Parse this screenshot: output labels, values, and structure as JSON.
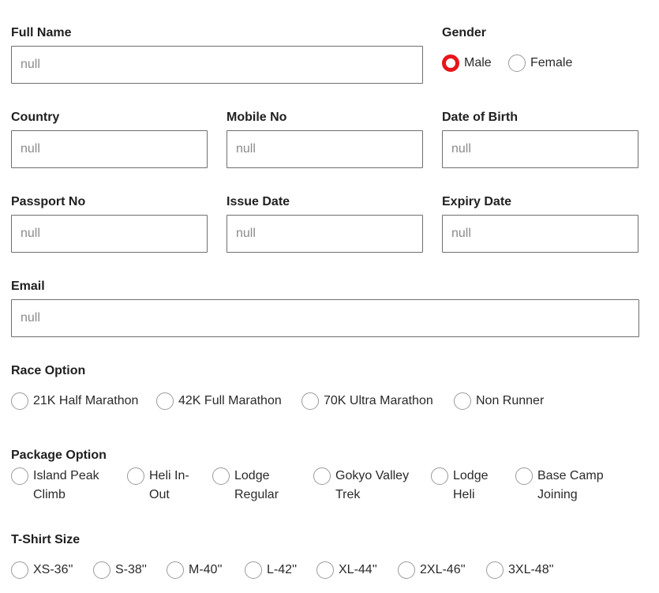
{
  "personal": {
    "full_name_label": "Full Name",
    "full_name_placeholder": "null",
    "gender_label": "Gender",
    "gender_options": [
      "Male",
      "Female"
    ],
    "gender_selected": "Male",
    "country_label": "Country",
    "country_placeholder": "null",
    "mobile_label": "Mobile No",
    "mobile_placeholder": "null",
    "dob_label": "Date of Birth",
    "dob_placeholder": "null",
    "passport_label": "Passport No",
    "passport_placeholder": "null",
    "issue_label": "Issue Date",
    "issue_placeholder": "null",
    "expiry_label": "Expiry Date",
    "expiry_placeholder": "null",
    "email_label": "Email",
    "email_placeholder": "null"
  },
  "race": {
    "label": "Race Option",
    "options": [
      "21K Half Marathon",
      "42K Full Marathon",
      "70K Ultra Marathon",
      "Non Runner"
    ]
  },
  "package": {
    "label": "Package Option",
    "options": [
      {
        "line1": "Island Peak",
        "line2": "Climb"
      },
      {
        "line1": "Heli In-",
        "line2": "Out"
      },
      {
        "line1": "Lodge",
        "line2": "Regular"
      },
      {
        "line1": "Gokyo Valley",
        "line2": "Trek"
      },
      {
        "line1": "Lodge",
        "line2": "Heli"
      },
      {
        "line1": "Base Camp",
        "line2": "Joining"
      }
    ]
  },
  "tshirt": {
    "label": "T-Shirt Size",
    "options": [
      "XS-36''",
      "S-38''",
      "M-40''",
      "L-42''",
      "XL-44''",
      "2XL-46''",
      "3XL-48''"
    ]
  },
  "colors": {
    "accent": "#e8141b",
    "border": "#6f6f6f",
    "placeholder": "#8a8a8a"
  },
  "icons": {
    "radio_unchecked": "radio-unchecked-icon",
    "radio_checked": "radio-checked-icon"
  }
}
